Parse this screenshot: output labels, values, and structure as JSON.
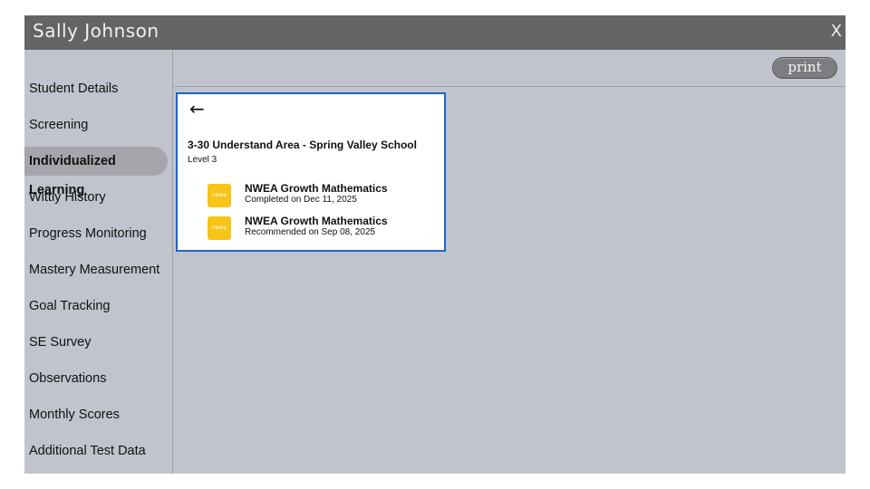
{
  "window": {
    "title": "Sally Johnson",
    "close_label": "X"
  },
  "sidebar": {
    "items": [
      {
        "label": "Student Details",
        "active": false
      },
      {
        "label": "Screening",
        "active": false
      },
      {
        "label": "Individualized Learning",
        "active": true
      },
      {
        "label": "Wittly History",
        "active": false
      },
      {
        "label": "Progress Monitoring",
        "active": false
      },
      {
        "label": "Mastery Measurement",
        "active": false
      },
      {
        "label": "Goal Tracking",
        "active": false
      },
      {
        "label": "SE Survey",
        "active": false
      },
      {
        "label": "Observations",
        "active": false
      },
      {
        "label": "Monthly Scores",
        "active": false
      },
      {
        "label": "Additional Test Data",
        "active": false
      }
    ]
  },
  "toolbar": {
    "print_label": "print"
  },
  "card": {
    "back_icon": "←",
    "heading": "3-30 Understand Area - Spring Valley School",
    "level": "Level 3",
    "assessments": [
      {
        "logo_text": "nwea",
        "name": "NWEA Growth Mathematics",
        "date_text": "Completed on Dec 11, 2025"
      },
      {
        "logo_text": "nwea",
        "name": "NWEA Growth Mathematics",
        "date_text": "Recommended on Sep 08, 2025"
      }
    ]
  },
  "colors": {
    "titlebar": "#636466",
    "background": "#c1c4cc",
    "active_item": "#a4a6ab",
    "card_border": "#1f63c7",
    "nwea_logo": "#f7c418"
  }
}
